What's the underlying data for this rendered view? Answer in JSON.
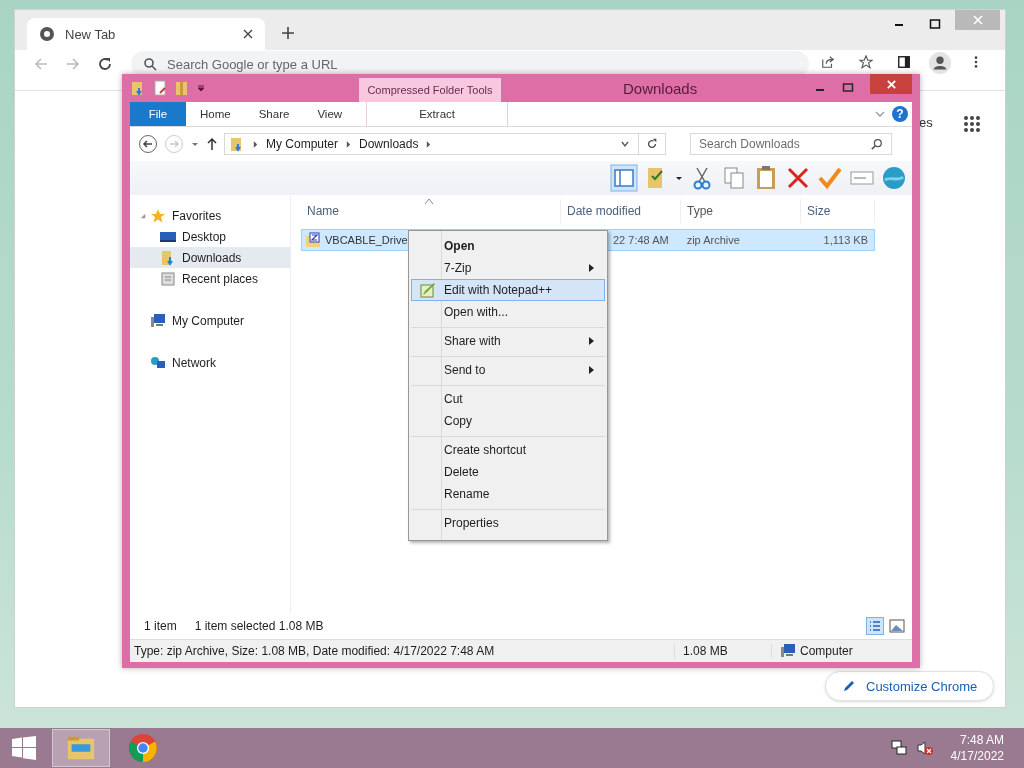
{
  "browser": {
    "tab": {
      "title": "New Tab"
    },
    "omnibox": {
      "placeholder": "Search Google or type a URL"
    },
    "shortcuts_fragment": "es",
    "customize_button": "Customize Chrome"
  },
  "explorer": {
    "title": "Downloads",
    "context_group": "Compressed Folder Tools",
    "help_glyph": "?",
    "ribbon_tabs": [
      {
        "label": "File",
        "kind": "file"
      },
      {
        "label": "Home",
        "kind": "tab"
      },
      {
        "label": "Share",
        "kind": "tab"
      },
      {
        "label": "View",
        "kind": "tab"
      },
      {
        "label": "Extract",
        "kind": "context"
      }
    ],
    "breadcrumb": [
      "My Computer",
      "Downloads"
    ],
    "search": {
      "placeholder": "Search Downloads"
    },
    "nav": [
      {
        "label": "Favorites",
        "selected": false,
        "children": [
          {
            "label": "Desktop",
            "selected": false
          },
          {
            "label": "Downloads",
            "selected": true
          },
          {
            "label": "Recent places",
            "selected": false
          }
        ]
      },
      {
        "label": "My Computer",
        "selected": false
      },
      {
        "label": "Network",
        "selected": false
      }
    ],
    "columns": [
      "Name",
      "Date modified",
      "Type",
      "Size"
    ],
    "rows": [
      {
        "name": "VBCABLE_Drive",
        "date": "22 7:48 AM",
        "type": "zip Archive",
        "size": "1,113 KB",
        "selected": true
      }
    ],
    "status": {
      "count": "1 item",
      "selection": "1 item selected  1.08 MB"
    },
    "details": {
      "summary": "Type: zip Archive, Size: 1.08 MB, Date modified: 4/17/2022 7:48 AM",
      "size": "1.08 MB",
      "location": "Computer"
    }
  },
  "context_menu": [
    [
      {
        "label": "Open",
        "bold": true,
        "submenu": false,
        "selected": false,
        "icon": false
      },
      {
        "label": "7-Zip",
        "bold": false,
        "submenu": true,
        "selected": false,
        "icon": false
      },
      {
        "label": "Edit with Notepad++",
        "bold": false,
        "submenu": false,
        "selected": true,
        "icon": true
      },
      {
        "label": "Open with...",
        "bold": false,
        "submenu": false,
        "selected": false,
        "icon": false
      }
    ],
    [
      {
        "label": "Share with",
        "bold": false,
        "submenu": true,
        "selected": false,
        "icon": false
      }
    ],
    [
      {
        "label": "Send to",
        "bold": false,
        "submenu": true,
        "selected": false,
        "icon": false
      }
    ],
    [
      {
        "label": "Cut",
        "bold": false,
        "submenu": false,
        "selected": false,
        "icon": false
      },
      {
        "label": "Copy",
        "bold": false,
        "submenu": false,
        "selected": false,
        "icon": false
      }
    ],
    [
      {
        "label": "Create shortcut",
        "bold": false,
        "submenu": false,
        "selected": false,
        "icon": false
      },
      {
        "label": "Delete",
        "bold": false,
        "submenu": false,
        "selected": false,
        "icon": false
      },
      {
        "label": "Rename",
        "bold": false,
        "submenu": false,
        "selected": false,
        "icon": false
      }
    ],
    [
      {
        "label": "Properties",
        "bold": false,
        "submenu": false,
        "selected": false,
        "icon": false
      }
    ]
  ],
  "taskbar": {
    "apps": [
      {
        "kind": "explorer",
        "selected": true
      },
      {
        "kind": "chrome",
        "selected": false
      }
    ],
    "time": "7:48 AM",
    "date": "4/17/2022"
  }
}
